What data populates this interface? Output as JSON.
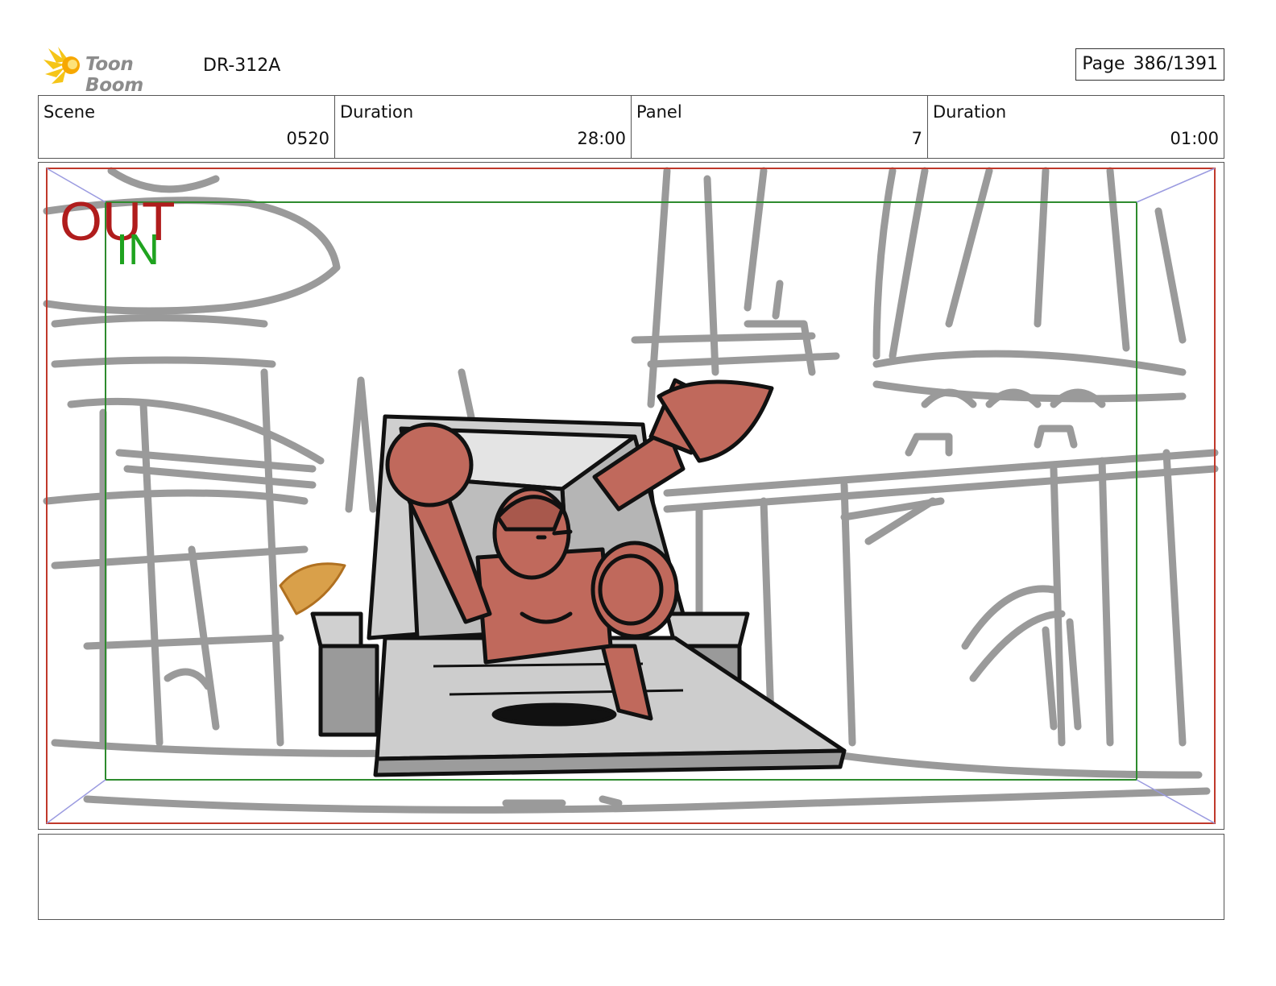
{
  "header": {
    "logo_text": "Toon Boom",
    "production_code": "DR-312A",
    "page_label": "Page",
    "page_value": "386/1391"
  },
  "info": [
    {
      "label": "Scene",
      "value": "0520"
    },
    {
      "label": "Duration",
      "value": "28:00"
    },
    {
      "label": "Panel",
      "value": "7"
    },
    {
      "label": "Duration",
      "value": "01:00"
    }
  ],
  "panel": {
    "out_marker": "OUT",
    "in_marker": "IN",
    "colors": {
      "out_frame": "#c0392b",
      "in_frame": "#2e8b2e",
      "sketch_gray": "#9a9a9a",
      "character": "#c0695c",
      "ink": "#111111",
      "platform": "#c9c9c9"
    }
  },
  "caption": {
    "text": ""
  }
}
